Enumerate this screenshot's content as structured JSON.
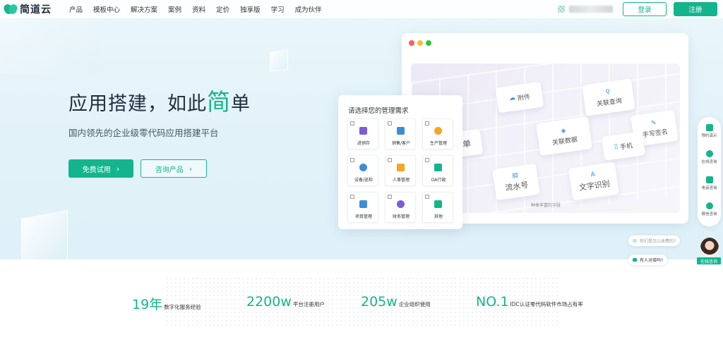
{
  "nav": {
    "logo": "简道云",
    "menu": [
      "产品",
      "模板中心",
      "解决方案",
      "案例",
      "资料",
      "定价",
      "独享版",
      "学习",
      "成为伙伴"
    ],
    "login": "登录",
    "register": "注册"
  },
  "hero": {
    "title_prefix": "应用搭建，如此",
    "title_accent": "简",
    "title_suffix": "单",
    "subtitle": "国内领先的企业级零代码应用搭建平台",
    "primary_button": "免费试用",
    "secondary_button": "咨询产品"
  },
  "canvas": {
    "tiles": {
      "attachment": "附件",
      "relation_query": "关联查询",
      "relation_data": "关联数据",
      "signature": "手写签名",
      "form": "表单",
      "phone": "手机",
      "serial": "流水号",
      "ocr": "文字识别"
    },
    "note": "种类丰富的字段"
  },
  "needs": {
    "title": "请选择您的管理需求",
    "options": [
      "进销存",
      "销售/客户",
      "生产管理",
      "设备/巡检",
      "人事管理",
      "OA行政",
      "项目管理",
      "财务管理",
      "其他"
    ]
  },
  "sidebar": {
    "items": [
      "预约演示",
      "在线咨询",
      "电话咨询",
      "微信咨询"
    ]
  },
  "chat": {
    "question": "你们是怎么收费的?",
    "human": "有人对接吗?",
    "online": "在线咨询"
  },
  "stats": [
    {
      "num": "19年",
      "label": "数字化服务经验"
    },
    {
      "num": "2200w",
      "label": "平台注册用户"
    },
    {
      "num": "205w",
      "label": "企业组织使用"
    },
    {
      "num": "NO.1",
      "label": "IDC认证零代码软件市场占有率"
    }
  ],
  "colors": {
    "brand": "#14b58c",
    "hero_bg": "#e2f2f9",
    "icon_blue": "#3d8dd8",
    "traffic": [
      "#ff5f57",
      "#febc2e",
      "#28c840"
    ],
    "option_icons": [
      "#7b5cd6",
      "#3d8dd8",
      "#f5a623",
      "#3d8dd8",
      "#f5a623",
      "#14b58c",
      "#3d8dd8",
      "#7b5cd6",
      "#14b58c"
    ]
  }
}
